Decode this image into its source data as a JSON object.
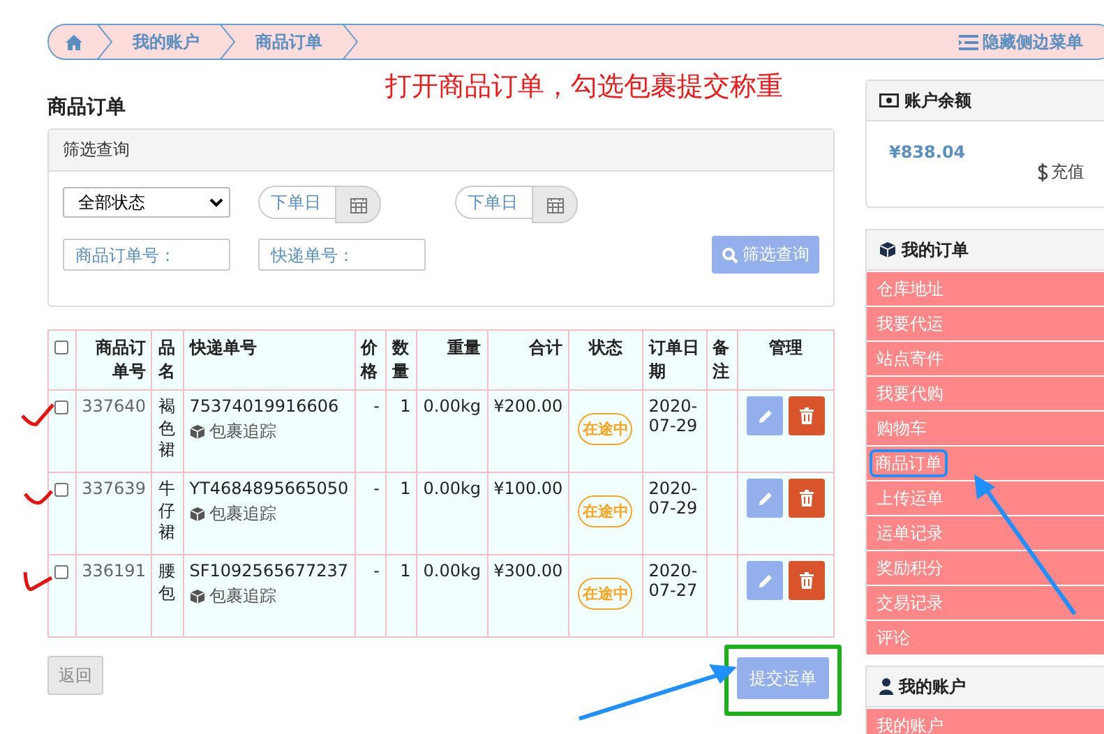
{
  "breadcrumb": {
    "items": [
      {
        "label": "我的账户"
      },
      {
        "label": "商品订单"
      }
    ],
    "toggle_label": "隐藏侧边菜单"
  },
  "annotation": {
    "text": "打开商品订单，勾选包裹提交称重"
  },
  "page_title": "商品订单",
  "filter": {
    "title": "筛选查询",
    "status_select": "全部状态",
    "date_from": {
      "placeholder": "下单日"
    },
    "date_to": {
      "placeholder": "下单日"
    },
    "order_no": {
      "placeholder": "商品订单号："
    },
    "tracking_no": {
      "placeholder": "快递单号："
    },
    "query_button": "筛选查询"
  },
  "table": {
    "all_checked": false,
    "columns": [
      "商品订单号",
      "品名",
      "快递单号",
      "价格",
      "数量",
      "重量",
      "合计",
      "状态",
      "订单日期",
      "备注",
      "管理"
    ],
    "rows": [
      {
        "checked": false,
        "order_no": "337640",
        "name": "褐色裙",
        "tracking_no": "75374019916606",
        "track_link": "包裹追踪",
        "price": "-",
        "qty": "1",
        "weight": "0.00kg",
        "total": "¥200.00",
        "status": "在途中",
        "date": "2020-07-29"
      },
      {
        "checked": false,
        "order_no": "337639",
        "name": "牛仔裙",
        "tracking_no": "YT4684895665050",
        "track_link": "包裹追踪",
        "price": "-",
        "qty": "1",
        "weight": "0.00kg",
        "total": "¥100.00",
        "status": "在途中",
        "date": "2020-07-29"
      },
      {
        "checked": false,
        "order_no": "336191",
        "name": "腰包",
        "tracking_no": "SF1092565677237",
        "track_link": "包裹追踪",
        "price": "-",
        "qty": "1",
        "weight": "0.00kg",
        "total": "¥300.00",
        "status": "在途中",
        "date": "2020-07-27"
      }
    ]
  },
  "back_button": "返回",
  "submit_button": "提交运单",
  "sidebar": {
    "balance": {
      "title": "账户余额",
      "amount": "¥838.04",
      "recharge": "充值"
    },
    "orders": {
      "title": "我的订单",
      "items": [
        {
          "label": "仓库地址",
          "annotated": false
        },
        {
          "label": "我要代运",
          "annotated": false
        },
        {
          "label": "站点寄件",
          "annotated": false
        },
        {
          "label": "我要代购",
          "annotated": false
        },
        {
          "label": "购物车",
          "annotated": false
        },
        {
          "label": "商品订单",
          "annotated": true
        },
        {
          "label": "上传运单",
          "annotated": false
        },
        {
          "label": "运单记录",
          "annotated": false
        },
        {
          "label": "奖励积分",
          "annotated": false
        },
        {
          "label": "交易记录",
          "annotated": false
        },
        {
          "label": "评论",
          "annotated": false
        }
      ]
    },
    "account": {
      "title": "我的账户",
      "items": [
        {
          "label": "我的账户"
        }
      ]
    }
  }
}
